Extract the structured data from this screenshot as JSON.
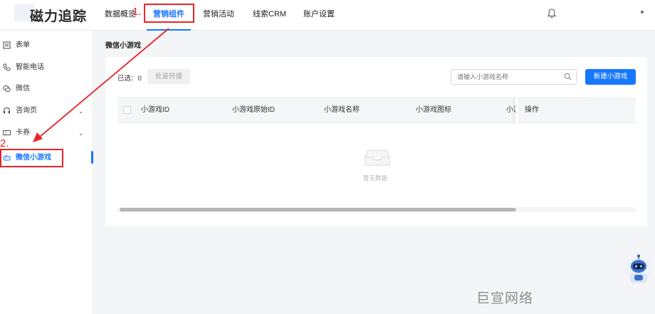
{
  "app": {
    "logo_text": "磁力追踪"
  },
  "nav": [
    "数据概览",
    "营销组件",
    "营销活动",
    "线索CRM",
    "账户设置"
  ],
  "sidebar": {
    "items": [
      {
        "label": "表单",
        "icon": "form-icon"
      },
      {
        "label": "智能电话",
        "icon": "phone-icon"
      },
      {
        "label": "微信",
        "icon": "wechat-icon"
      },
      {
        "label": "咨询页",
        "icon": "headset-icon"
      },
      {
        "label": "卡券",
        "icon": "coupon-icon"
      },
      {
        "label": "微信小游戏",
        "icon": "gamepad-icon"
      }
    ]
  },
  "page": {
    "title": "微信小游戏"
  },
  "toolbar": {
    "selected_label": "已选",
    "selected_sep": "：",
    "selected_count": "0",
    "batch_label": "批量转播",
    "search_placeholder": "请输入小游戏名称",
    "new_label": "新建小游戏"
  },
  "table": {
    "columns": [
      "小游戏ID",
      "小游戏原始ID",
      "小游戏名称",
      "小游戏图标",
      "小游",
      "操作"
    ],
    "empty_text": "暂无数据"
  },
  "annotations": {
    "step1": "1.",
    "step2": "2."
  },
  "watermark": "巨宣网络",
  "colors": {
    "accent": "#1677ff",
    "annotation": "#e8252b"
  }
}
